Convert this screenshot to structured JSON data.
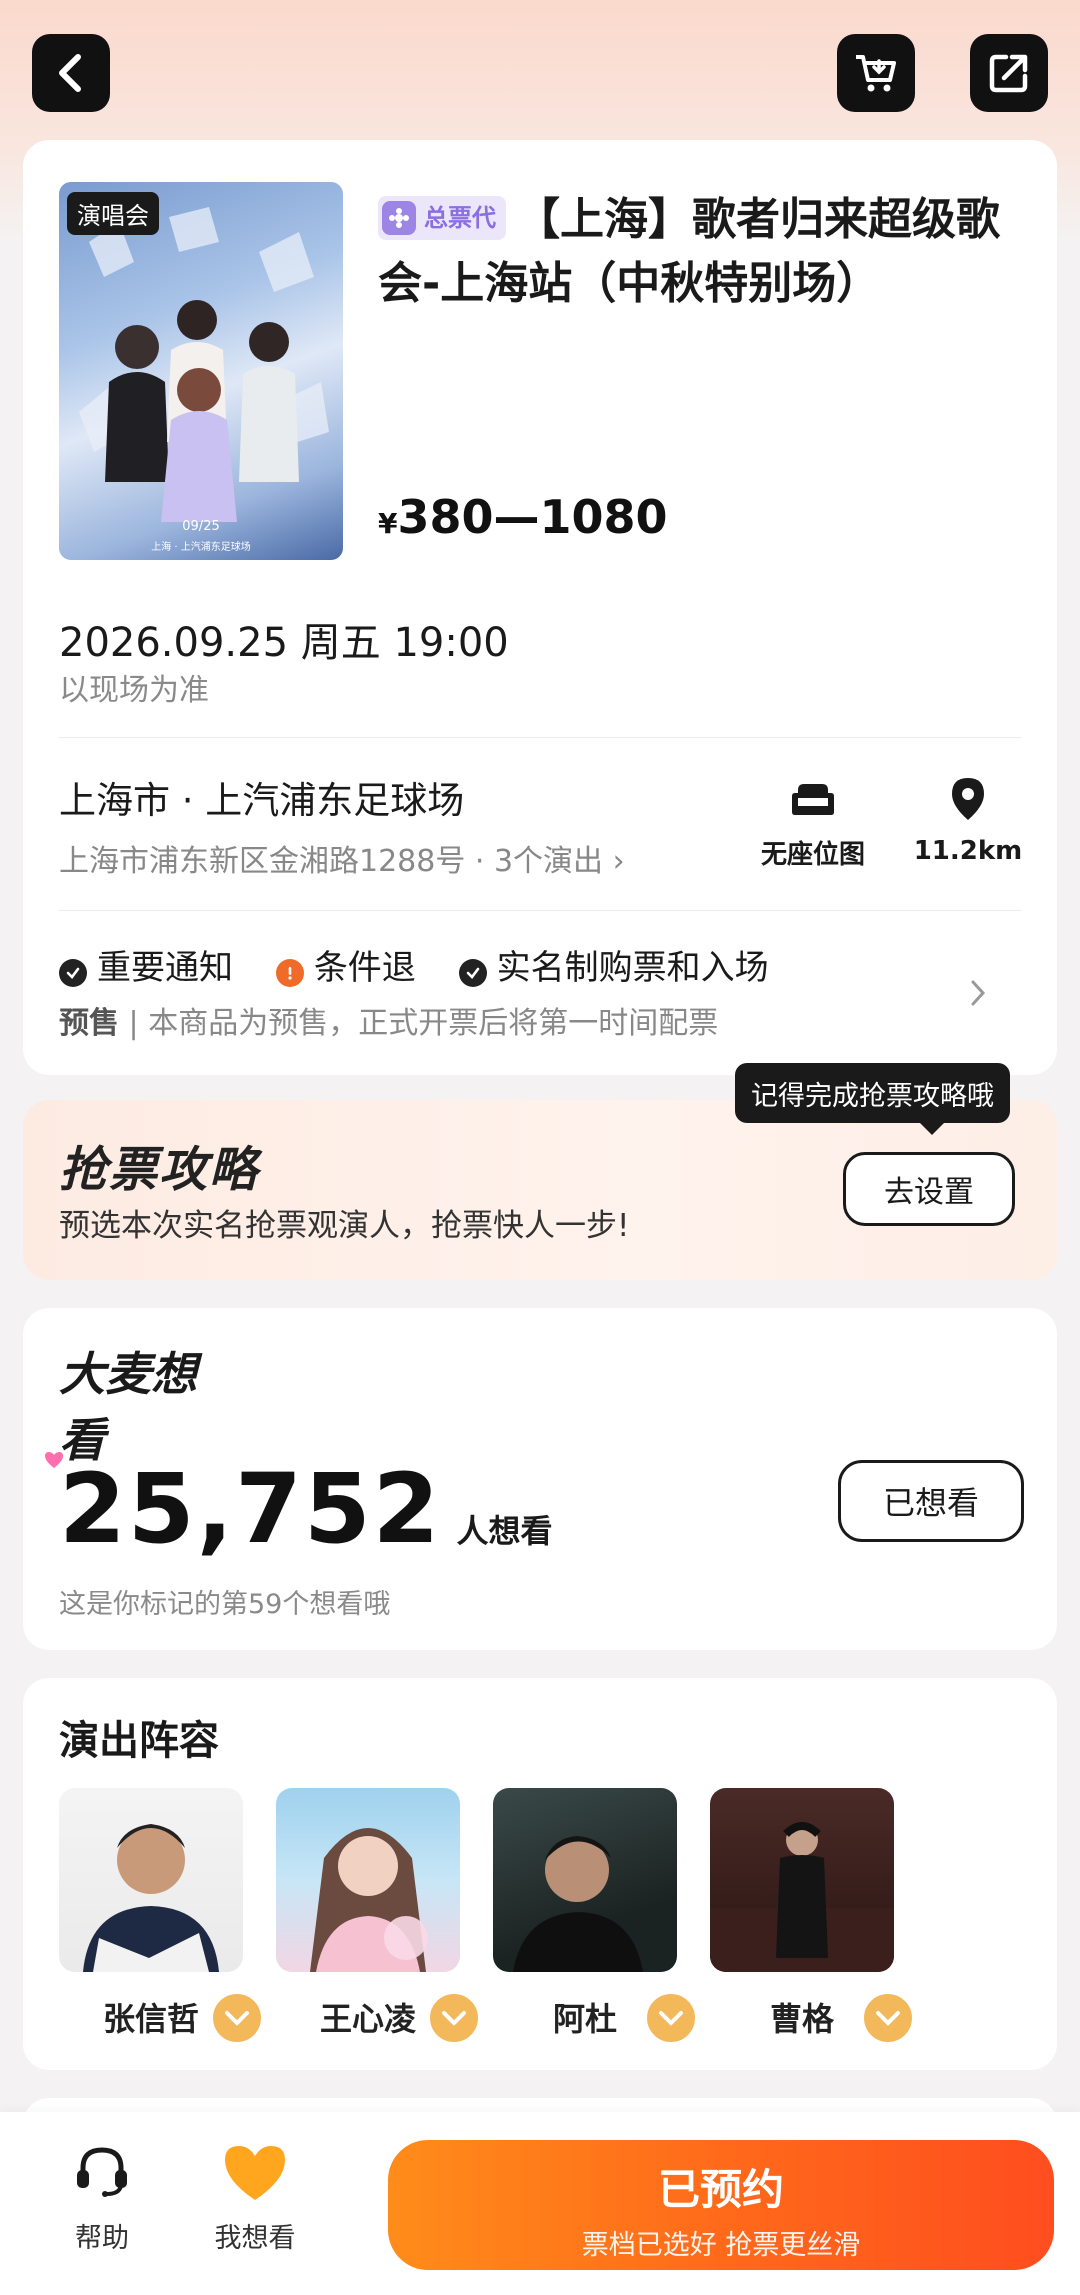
{
  "header": {
    "back_icon": "chevron-left-icon",
    "cart_icon": "cart-icon",
    "share_icon": "share-icon"
  },
  "event": {
    "poster_tag": "演唱会",
    "agent_badge": "总票代",
    "title": "【上海】歌者归来超级歌会-上海站（中秋特别场）",
    "currency": "¥",
    "price": "380—1080",
    "datetime": "2026.09.25 周五 19:00",
    "datetime_note": "以现场为准",
    "venue": "上海市 · 上汽浦东足球场",
    "address": "上海市浦东新区金湘路1288号 · 3个演出 ›",
    "seatmap_label": "无座位图",
    "distance": "11.2km",
    "notices": [
      {
        "label": "重要通知",
        "color": "#222222"
      },
      {
        "label": "条件退",
        "color": "#f06a2a"
      },
      {
        "label": "实名制购票和入场",
        "color": "#222222"
      }
    ],
    "presale_tag": "预售",
    "presale_text": "| 本商品为预售，正式开票后将第一时间配票"
  },
  "strategy": {
    "tooltip": "记得完成抢票攻略哦",
    "title": "抢票攻略",
    "desc": "预选本次实名抢票观演人，抢票快人一步!",
    "button": "去设置"
  },
  "want": {
    "title": "大麦想看",
    "count": "25,752",
    "unit": "人想看",
    "button": "已想看",
    "note": "这是你标记的第59个想看哦"
  },
  "lineup": {
    "title": "演出阵容",
    "members": [
      {
        "name": "张信哲"
      },
      {
        "name": "王心凌"
      },
      {
        "name": "阿杜"
      },
      {
        "name": "曹格"
      }
    ]
  },
  "bottom": {
    "help_label": "帮助",
    "want_label": "我想看",
    "cta_main": "已预约",
    "cta_sub": "票档已选好 抢票更丝滑"
  },
  "colors": {
    "accent": "#ff5e1f",
    "accent_end": "#ff8a1d",
    "heart": "#ffa51e"
  }
}
